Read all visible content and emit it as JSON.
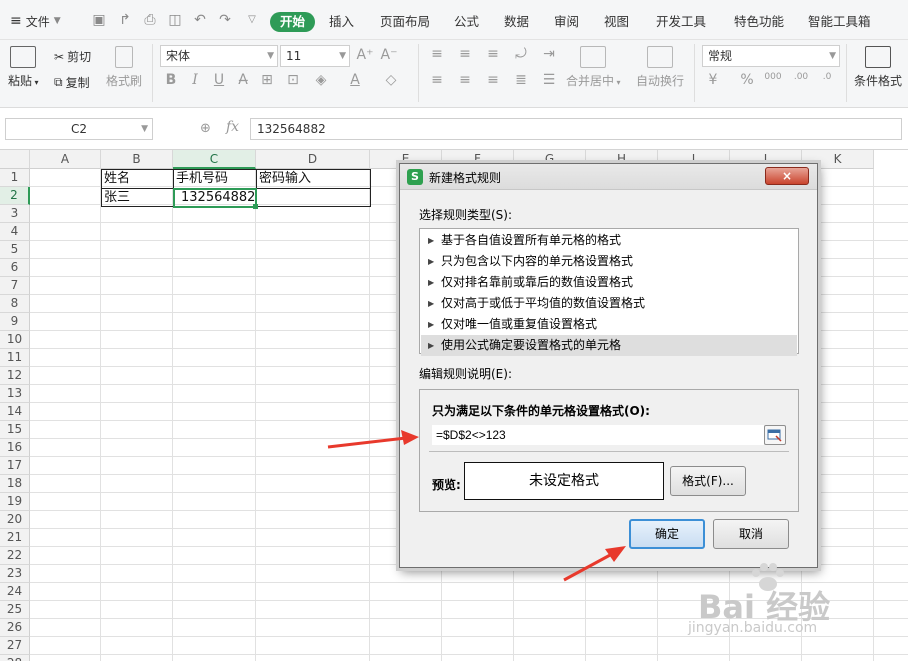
{
  "menu": {
    "file_label": "文件",
    "tabs": [
      "开始",
      "插入",
      "页面布局",
      "公式",
      "数据",
      "审阅",
      "视图",
      "开发工具",
      "特色功能",
      "智能工具箱"
    ],
    "active_tab": "开始"
  },
  "ribbon": {
    "paste": "粘贴",
    "cut": "剪切",
    "copy": "复制",
    "format_painter": "格式刷",
    "font_name": "宋体",
    "font_size": "11",
    "merge_center": "合并居中",
    "wrap_text": "自动换行",
    "number_format": "常规",
    "conditional_format": "条件格式"
  },
  "formula_bar": {
    "name_box": "C2",
    "fx": "fx",
    "content": "132564882"
  },
  "sheet": {
    "columns": [
      "A",
      "B",
      "C",
      "D",
      "E",
      "F",
      "G",
      "H",
      "I",
      "J",
      "K"
    ],
    "rows": [
      "1",
      "2",
      "3",
      "4",
      "5",
      "6",
      "7",
      "8",
      "9",
      "10",
      "11",
      "12",
      "13",
      "14",
      "15",
      "16",
      "17",
      "18",
      "19",
      "20",
      "21",
      "22",
      "23",
      "24",
      "25",
      "26",
      "27",
      "28"
    ],
    "selected_cell": "C2",
    "cells": {
      "B1": "姓名",
      "C1": "手机号码",
      "D1": "密码输入",
      "B2": "张三",
      "C2": "132564882"
    }
  },
  "dialog": {
    "title": "新建格式规则",
    "close": "×",
    "rule_type_label": "选择规则类型(S):",
    "rule_types": [
      "基于各自值设置所有单元格的格式",
      "只为包含以下内容的单元格设置格式",
      "仅对排名靠前或靠后的数值设置格式",
      "仅对高于或低于平均值的数值设置格式",
      "仅对唯一值或重复值设置格式",
      "使用公式确定要设置格式的单元格"
    ],
    "selected_rule_index": 5,
    "edit_label": "编辑规则说明(E):",
    "formula_heading": "只为满足以下条件的单元格设置格式(O):",
    "formula": "=$D$2<>123",
    "preview_label": "预览:",
    "preview_text": "未设定格式",
    "format_button": "格式(F)...",
    "ok": "确定",
    "cancel": "取消"
  },
  "watermark": {
    "brand": "Bai 经验",
    "url": "jingyan.baidu.com"
  },
  "colors": {
    "accent": "#2e9b57",
    "annotation_arrow": "#e8392c"
  }
}
